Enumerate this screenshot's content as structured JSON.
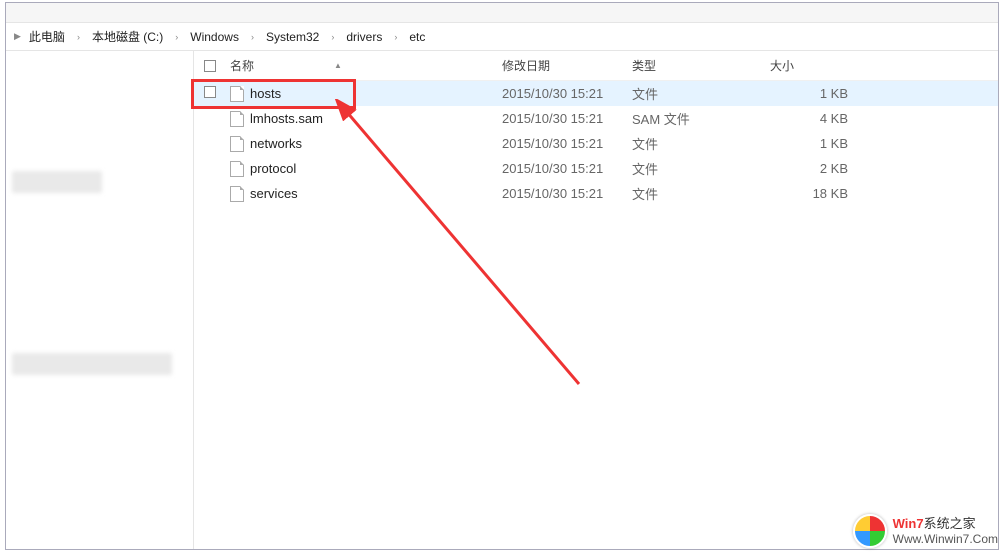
{
  "breadcrumb": [
    "此电脑",
    "本地磁盘 (C:)",
    "Windows",
    "System32",
    "drivers",
    "etc"
  ],
  "columns": {
    "name": "名称",
    "date": "修改日期",
    "type": "类型",
    "size": "大小"
  },
  "files": [
    {
      "name": "hosts",
      "date": "2015/10/30 15:21",
      "type": "文件",
      "size": "1 KB",
      "selected": true,
      "checkbox": true
    },
    {
      "name": "lmhosts.sam",
      "date": "2015/10/30 15:21",
      "type": "SAM 文件",
      "size": "4 KB",
      "selected": false,
      "checkbox": false
    },
    {
      "name": "networks",
      "date": "2015/10/30 15:21",
      "type": "文件",
      "size": "1 KB",
      "selected": false,
      "checkbox": false
    },
    {
      "name": "protocol",
      "date": "2015/10/30 15:21",
      "type": "文件",
      "size": "2 KB",
      "selected": false,
      "checkbox": false
    },
    {
      "name": "services",
      "date": "2015/10/30 15:21",
      "type": "文件",
      "size": "18 KB",
      "selected": false,
      "checkbox": false
    }
  ],
  "watermark": {
    "line1_prefix": "W",
    "line1_colored": "in7",
    "line1_suffix": "系统之家",
    "line2": "Www.Winwin7.Com"
  }
}
